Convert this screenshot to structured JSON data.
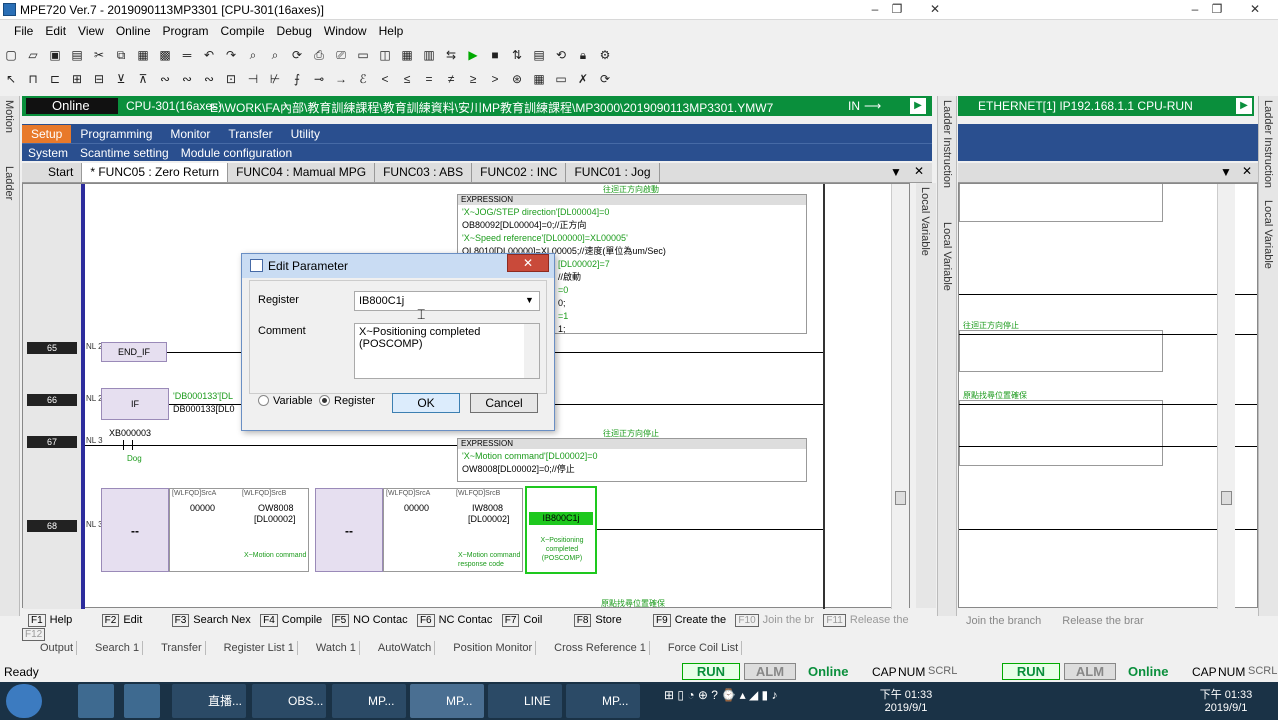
{
  "window": {
    "title": "MPE720 Ver.7 - 2019090113MP3301 [CPU-301(16axes)]"
  },
  "menu": [
    "File",
    "Edit",
    "View",
    "Online",
    "Program",
    "Compile",
    "Debug",
    "Window",
    "Help"
  ],
  "online_bar": {
    "status": "Online",
    "cpu": "CPU-301(16axes)",
    "path": "E:\\WORK\\FA內部\\教育訓練課程\\教育訓練資料\\安川MP教育訓練課程\\MP3000\\2019090113MP3301.YMW7",
    "in_label": "IN",
    "ethernet": "ETHERNET[1] IP192.168.1.1 CPU-RUN"
  },
  "main_tabs": [
    "Setup",
    "Programming",
    "Monitor",
    "Transfer",
    "Utility"
  ],
  "sub_tabs": [
    "System",
    "Scantime setting",
    "Module configuration"
  ],
  "doc_tabs": [
    "Start",
    "* FUNC05 : Zero Return",
    "FUNC04 : Mamual MPG",
    "FUNC03 : ABS",
    "FUNC02 : INC",
    "FUNC01 : Jog"
  ],
  "side_labels": {
    "motion": "Motion",
    "ladder": "Ladder",
    "ladder_instruction": "Ladder Instruction",
    "local_variable": "Local Variable"
  },
  "ladder": {
    "expr1_header": "EXPRESSION",
    "expr1_lines": [
      "'X~JOG/STEP direction'[DL00004]=0",
      "OB80092[DL00004]=0;//正方向",
      "'X~Speed reference'[DL00000]=XL00005'",
      "OL8010[DL00000]=XL00005;//速度(單位為um/Sec)",
      "[DL00002]=7",
      "//啟動",
      "=0",
      "0;",
      "=1",
      "1;"
    ],
    "top_comment": "往迴正方向啟動",
    "rungs": [
      {
        "num": "65",
        "nl": "NL 2",
        "label": "END_IF"
      },
      {
        "num": "66",
        "nl": "NL 2",
        "label": "IF",
        "comment": "'DB000133'[DL",
        "text2": "DB000133[DL0"
      },
      {
        "num": "67",
        "nl": "NL 3",
        "contact": "XB000003",
        "contact_comment": "Dog",
        "expr_header": "EXPRESSION",
        "expr_lines": [
          "'X~Motion command'[DL00002]=0",
          "OW8008[DL00002]=0;//停止"
        ],
        "note": "往迴正方向停止"
      },
      {
        "num": "68",
        "nl": "NL 3",
        "dash1": "--",
        "blk1_src": "[WLFQD]SrcA",
        "blk1_srcb": "[WLFQD]SrcB",
        "blk1_a": "00000",
        "blk1_b": "OW8008",
        "blk1_breg": "[DL00002]",
        "blk1_bcomment": "X~Motion command",
        "dash2": "--",
        "blk2_src": "[WLFQD]SrcA",
        "blk2_srcb": "[WLFQD]SrcB",
        "blk2_a": "00000",
        "blk2_b": "IW8008",
        "blk2_breg": "[DL00002]",
        "blk2_bcomment": "X~Motion command response code",
        "coil": "IB800C1j",
        "coil_comment": "X~Positioning completed (POSCOMP)"
      }
    ],
    "bottom_note": "原點找尋位置確保"
  },
  "right_notes": [
    "往迴正方向停止",
    "原點找尋位置確保"
  ],
  "fkeys": [
    {
      "k": "F1",
      "label": "Help"
    },
    {
      "k": "F2",
      "label": "Edit"
    },
    {
      "k": "F3",
      "label": "Search Nex"
    },
    {
      "k": "F4",
      "label": "Compile"
    },
    {
      "k": "F5",
      "label": "NO Contac"
    },
    {
      "k": "F6",
      "label": "NC Contac"
    },
    {
      "k": "F7",
      "label": "Coil"
    },
    {
      "k": "F8",
      "label": "Store"
    },
    {
      "k": "F9",
      "label": "Create the"
    },
    {
      "k": "F10",
      "label": "Join the br"
    },
    {
      "k": "F11",
      "label": "Release the"
    },
    {
      "k": "F12",
      "label": ""
    }
  ],
  "fkeys_right": [
    "Join the branch",
    "Release the brar"
  ],
  "pane_tabs": [
    "Output",
    "Search 1",
    "Transfer",
    "Register List 1",
    "Watch 1",
    "AutoWatch",
    "Position Monitor",
    "Cross Reference 1",
    "Force Coil List"
  ],
  "status": {
    "ready": "Ready",
    "run": "RUN",
    "alm": "ALM",
    "online": "Online",
    "cap": "CAP",
    "num": "NUM",
    "scrl": "SCRL"
  },
  "dialog": {
    "title": "Edit Parameter",
    "register_label": "Register",
    "register_value": "IB800C1j",
    "comment_label": "Comment",
    "comment_value": "X~Positioning completed (POSCOMP)",
    "radio_variable": "Variable",
    "radio_register": "Register",
    "ok": "OK",
    "cancel": "Cancel"
  },
  "taskbar": {
    "items": [
      "直播...",
      "OBS...",
      "MP...",
      "MP...",
      "LINE",
      "MP..."
    ],
    "time": "下午 01:33",
    "date": "2019/9/1"
  }
}
